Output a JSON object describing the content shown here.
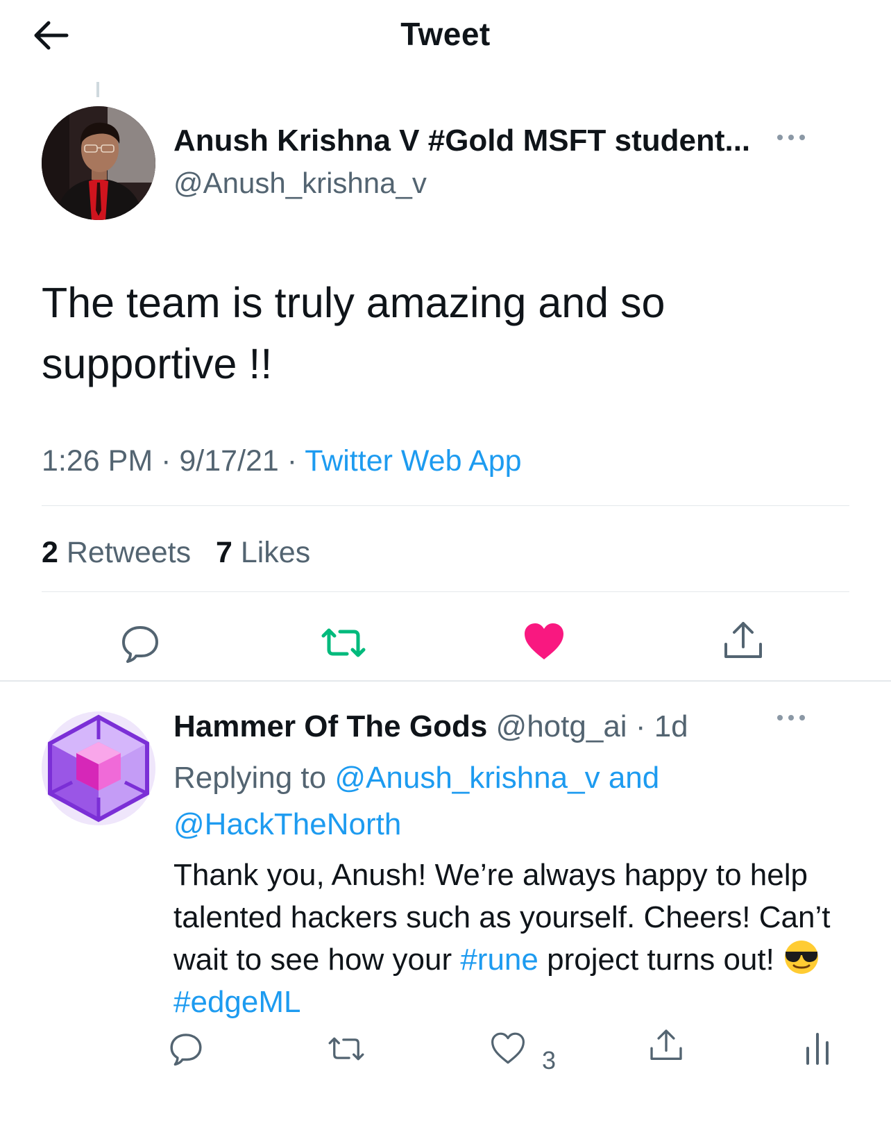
{
  "header": {
    "title": "Tweet",
    "back_icon": "arrow-left-icon"
  },
  "tweet": {
    "author_name": "Anush Krishna V #Gold MSFT student...",
    "author_handle": "@Anush_krishna_v",
    "text": "The team is truly amazing and so supportive !!",
    "time": "1:26 PM",
    "separator": "·",
    "date": "9/17/21",
    "source": "Twitter Web App",
    "retweets_count": "2",
    "retweets_label": "Retweets",
    "likes_count": "7",
    "likes_label": "Likes",
    "liked": true,
    "retweeted": true
  },
  "reply": {
    "author_name": "Hammer Of The Gods",
    "author_handle": "@hotg_ai",
    "separator": "·",
    "age": "1d",
    "replying_prefix": "Replying to",
    "replying_user1": "@Anush_krishna_v",
    "replying_and": "and",
    "replying_user2": "@HackTheNorth",
    "text_part1": "Thank you, Anush! We’re always happy to help talented hackers such as yourself. Cheers! Can’t wait to see how your",
    "hashtag1": "#rune",
    "text_part2": "project turns out!",
    "emoji": "sunglasses-face",
    "hashtag2": "#edgeML",
    "like_count": "3"
  },
  "colors": {
    "text": "#0f1419",
    "secondary": "#536471",
    "link": "#1d9bf0",
    "retweet_green": "#00ba7c",
    "like_red": "#f91880",
    "divider": "#e4e8eb"
  }
}
